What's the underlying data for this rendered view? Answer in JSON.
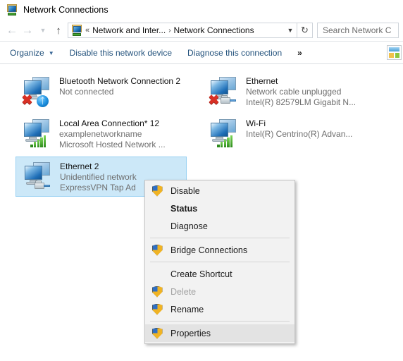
{
  "window": {
    "title": "Network Connections",
    "icon": "network-connections-icon"
  },
  "address_bar": {
    "back_icon": "back-arrow-icon",
    "forward_icon": "forward-arrow-icon",
    "history_icon": "recent-locations-chevron-icon",
    "up_icon": "up-arrow-icon",
    "breadcrumb_icon": "network-connections-icon",
    "breadcrumb_prefix": "«",
    "breadcrumb": [
      "Network and Inter...",
      "Network Connections"
    ],
    "separator": "›",
    "dropdown_icon": "chevron-down-icon",
    "refresh_icon": "refresh-icon",
    "search": {
      "placeholder": "Search Network C",
      "value": ""
    }
  },
  "toolbar": {
    "organize_label": "Organize",
    "organize_caret": "▼",
    "disable_label": "Disable this network device",
    "diagnose_label": "Diagnose this connection",
    "more_label": "»",
    "view_icon": "change-view-icon"
  },
  "connections": [
    {
      "name": "Bluetooth Network Connection 2",
      "status": "Not connected",
      "adapter": "",
      "icon": "dual-monitor-icon",
      "badge": "bluetooth-icon",
      "disconnected": true,
      "selected": false
    },
    {
      "name": "Ethernet",
      "status": "Network cable unplugged",
      "adapter": "Intel(R) 82579LM Gigabit N...",
      "icon": "dual-monitor-icon",
      "badge": "ethernet-plug-icon",
      "disconnected": true,
      "selected": false
    },
    {
      "name": "Local Area Connection* 12",
      "status": "examplenetworkname",
      "adapter": "Microsoft Hosted Network ...",
      "icon": "dual-monitor-icon",
      "badge": "signal-bars-icon",
      "disconnected": false,
      "selected": false
    },
    {
      "name": "Wi-Fi",
      "status": "",
      "adapter": "Intel(R) Centrino(R) Advan...",
      "icon": "dual-monitor-icon",
      "badge": "signal-bars-icon",
      "disconnected": false,
      "selected": false
    },
    {
      "name": "Ethernet 2",
      "status": "Unidentified network",
      "adapter": "ExpressVPN Tap Ad",
      "icon": "dual-monitor-icon",
      "badge": "ethernet-plug-icon",
      "disconnected": false,
      "selected": true
    }
  ],
  "context_menu": {
    "items": [
      {
        "label": "Disable",
        "shield": true,
        "bold": false,
        "disabled": false,
        "hover": false
      },
      {
        "label": "Status",
        "shield": false,
        "bold": true,
        "disabled": false,
        "hover": false
      },
      {
        "label": "Diagnose",
        "shield": false,
        "bold": false,
        "disabled": false,
        "hover": false
      },
      {
        "separator": true
      },
      {
        "label": "Bridge Connections",
        "shield": true,
        "bold": false,
        "disabled": false,
        "hover": false
      },
      {
        "separator": true
      },
      {
        "label": "Create Shortcut",
        "shield": false,
        "bold": false,
        "disabled": false,
        "hover": false
      },
      {
        "label": "Delete",
        "shield": true,
        "bold": false,
        "disabled": true,
        "hover": false
      },
      {
        "label": "Rename",
        "shield": true,
        "bold": false,
        "disabled": false,
        "hover": false
      },
      {
        "separator": true
      },
      {
        "label": "Properties",
        "shield": true,
        "bold": false,
        "disabled": false,
        "hover": true
      }
    ]
  },
  "colors": {
    "selection_fill": "#cce8f8",
    "selection_border": "#99d1f2",
    "link_blue": "#23527c",
    "menu_bg": "#f2f2f2",
    "menu_hover": "#e3e3e3",
    "shield_blue": "#2f6fc4",
    "shield_yellow": "#f0b323",
    "error_red": "#d93025",
    "signal_green": "#2e8b1e",
    "subtext_gray": "#6e6e6e"
  }
}
